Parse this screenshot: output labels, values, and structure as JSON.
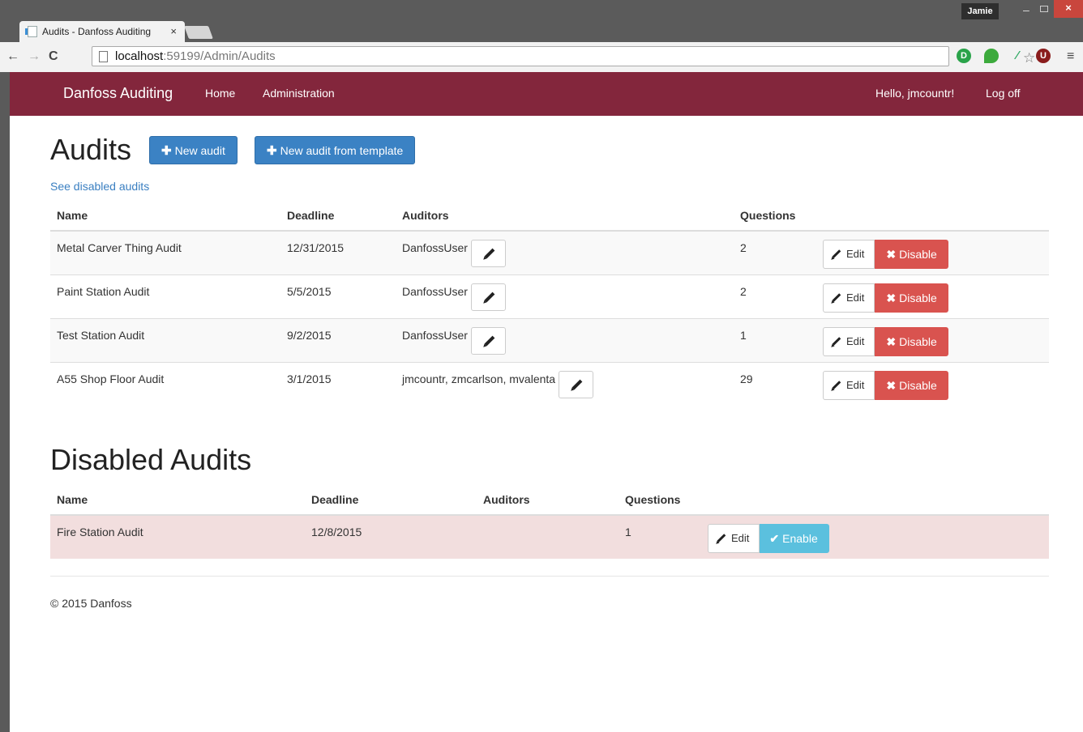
{
  "browser": {
    "tab_title": "Audits - Danfoss Auditing",
    "tab_close": "×",
    "user": "Jamie",
    "url_host": "localhost",
    "url_rest": ":59199/Admin/Audits",
    "star": "☆",
    "ext1": "D",
    "ext4": "U",
    "back": "←",
    "forward": "→",
    "reload": "C",
    "menu": "≡",
    "min": "–",
    "close": "×"
  },
  "navbar": {
    "brand": "Danfoss Auditing",
    "home": "Home",
    "administration": "Administration",
    "greeting": "Hello, jmcountr!",
    "logoff": "Log off"
  },
  "audits": {
    "heading": "Audits",
    "new_audit": "New audit",
    "new_from_template": "New audit from template",
    "see_disabled": "See disabled audits",
    "columns": [
      "Name",
      "Deadline",
      "Auditors",
      "Questions"
    ],
    "rows": [
      {
        "name": "Metal Carver Thing Audit",
        "deadline": "12/31/2015",
        "auditors": "DanfossUser",
        "questions": "2"
      },
      {
        "name": "Paint Station Audit",
        "deadline": "5/5/2015",
        "auditors": "DanfossUser",
        "questions": "2"
      },
      {
        "name": "Test Station Audit",
        "deadline": "9/2/2015",
        "auditors": "DanfossUser",
        "questions": "1"
      },
      {
        "name": "A55 Shop Floor Audit",
        "deadline": "3/1/2015",
        "auditors": "jmcountr, zmcarlson, mvalenta",
        "questions": "29"
      }
    ],
    "edit_label": "Edit",
    "disable_label": "Disable"
  },
  "disabled": {
    "heading": "Disabled Audits",
    "columns": [
      "Name",
      "Deadline",
      "Auditors",
      "Questions"
    ],
    "rows": [
      {
        "name": "Fire Station Audit",
        "deadline": "12/8/2015",
        "auditors": "",
        "questions": "1"
      }
    ],
    "edit_label": "Edit",
    "enable_label": "Enable"
  },
  "footer": "© 2015 Danfoss",
  "colors": {
    "navbar": "#83263c",
    "primary": "#3b82c4",
    "danger": "#d9534f",
    "info": "#5bc0de",
    "disabled_row": "#f2dede"
  }
}
